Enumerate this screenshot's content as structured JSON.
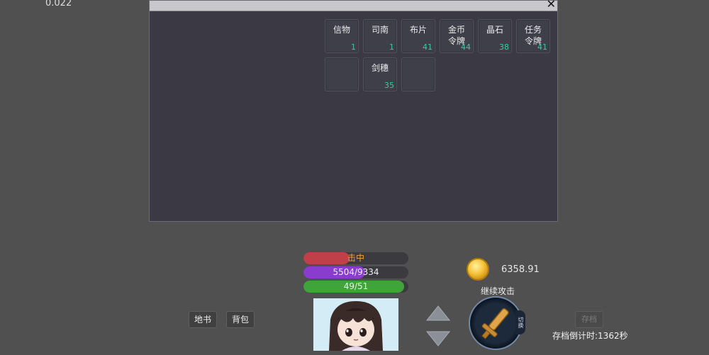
{
  "corner_value": "0.022",
  "inventory": {
    "close_label": "✕",
    "items": [
      {
        "name": "信物",
        "count": "1"
      },
      {
        "name": "司南",
        "count": "1"
      },
      {
        "name": "布片",
        "count": "41"
      },
      {
        "name": "金币\n令牌",
        "count": "44"
      },
      {
        "name": "晶石",
        "count": "38"
      },
      {
        "name": "任务\n令牌",
        "count": "41"
      },
      {
        "name": "",
        "count": ""
      },
      {
        "name": "剑穗",
        "count": "35"
      },
      {
        "name": "",
        "count": ""
      }
    ]
  },
  "status": {
    "hit_label": "击中",
    "hit_fraction": 0.44,
    "mp_label": "5504/9334",
    "mp_fraction": 0.59,
    "hp_label": "49/51",
    "hp_fraction": 0.96
  },
  "buttons": {
    "map_label": "地书",
    "bag_label": "背包",
    "save_label": "存档",
    "side_tab_label": "切换"
  },
  "gold": "6358.91",
  "action_label": "继续攻击",
  "save_countdown": "存档倒计时:1362秒",
  "colors": {
    "hit_bar": "#c0404a",
    "mp_bar": "#8a3ccf",
    "hp_bar": "#3fa43a",
    "count_text": "#3ec9a0"
  }
}
